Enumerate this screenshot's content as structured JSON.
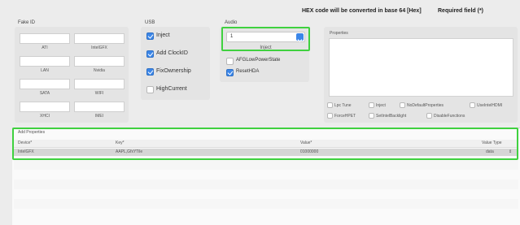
{
  "header": {
    "info": "HEX code will be converted in base 64 [Hex]",
    "required": "Required field (*)"
  },
  "fake_id": {
    "title": "Fake ID",
    "fields": [
      {
        "label": "ATI",
        "value": ""
      },
      {
        "label": "IntelGFX",
        "value": ""
      },
      {
        "label": "LAN",
        "value": ""
      },
      {
        "label": "Nvidia",
        "value": ""
      },
      {
        "label": "SATA",
        "value": ""
      },
      {
        "label": "WIFI",
        "value": ""
      },
      {
        "label": "XHCI",
        "value": ""
      },
      {
        "label": "IMEI",
        "value": ""
      }
    ]
  },
  "usb": {
    "title": "USB",
    "options": [
      {
        "label": "Inject",
        "checked": true
      },
      {
        "label": "Add ClockID",
        "checked": true
      },
      {
        "label": "FixOwnership",
        "checked": true
      },
      {
        "label": "HighCurrent",
        "checked": false
      }
    ]
  },
  "audio": {
    "title": "Audio",
    "select_value": "1",
    "select_caption": "Inject",
    "options": [
      {
        "label": "AFGLowPowerState",
        "checked": false
      },
      {
        "label": "ResetHDA",
        "checked": true
      }
    ]
  },
  "properties": {
    "title": "Properties",
    "flags": [
      {
        "label": "Lpc Tune",
        "checked": false
      },
      {
        "label": "Inject",
        "checked": false
      },
      {
        "label": "NoDefaultProperties",
        "checked": false
      },
      {
        "label": "UseIntelHDMI",
        "checked": false
      },
      {
        "label": "ForceHPET",
        "checked": false
      },
      {
        "label": "SetIntelBacklight",
        "checked": false
      },
      {
        "label": "DisableFunctions",
        "checked": false
      }
    ]
  },
  "add_properties": {
    "title": "Add Properties",
    "columns": [
      "Device*",
      "Key*",
      "Value*",
      "Value Type"
    ],
    "rows": [
      {
        "device": "IntelGFX",
        "key": "AAPL,GfxYTile",
        "value": "01000000",
        "type": "data"
      }
    ]
  },
  "colors": {
    "highlight": "#3fd13f",
    "checkbox_accent": "#3b86e8"
  }
}
